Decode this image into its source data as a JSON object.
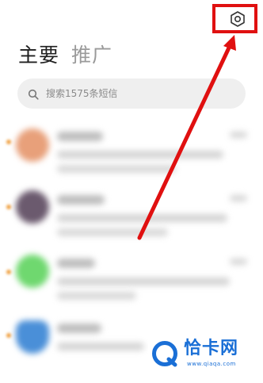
{
  "header": {
    "tab_primary": "主要",
    "tab_promo": "推广",
    "settings_icon": "settings-hex-icon"
  },
  "search": {
    "placeholder": "搜索1575条短信",
    "icon": "search-icon"
  },
  "conversations": [
    {
      "avatar_color": "#e8a07a"
    },
    {
      "avatar_color": "#6b5a6e"
    },
    {
      "avatar_color": "#6fd86f"
    },
    {
      "avatar_color": "#4a8fd8"
    }
  ],
  "annotation": {
    "color": "#e01010"
  },
  "watermark": {
    "title": "恰卡网",
    "url": "www.qiaqa.com",
    "color": "#1a6fd6"
  }
}
